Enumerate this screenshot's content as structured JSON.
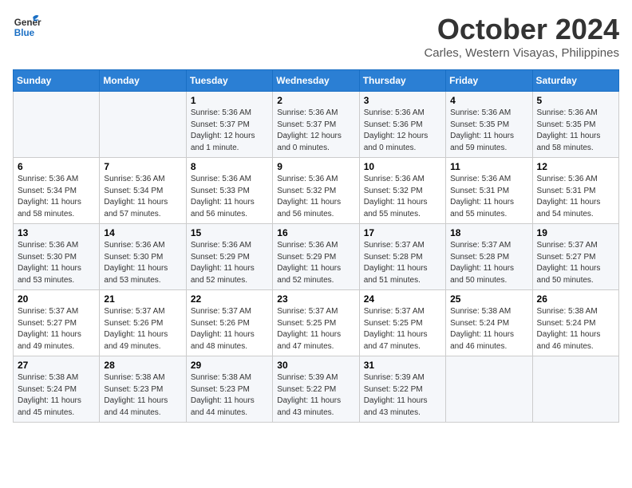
{
  "header": {
    "logo_line1": "General",
    "logo_line2": "Blue",
    "title": "October 2024",
    "subtitle": "Carles, Western Visayas, Philippines"
  },
  "weekdays": [
    "Sunday",
    "Monday",
    "Tuesday",
    "Wednesday",
    "Thursday",
    "Friday",
    "Saturday"
  ],
  "weeks": [
    [
      {
        "day": "",
        "info": ""
      },
      {
        "day": "",
        "info": ""
      },
      {
        "day": "1",
        "info": "Sunrise: 5:36 AM\nSunset: 5:37 PM\nDaylight: 12 hours\nand 1 minute."
      },
      {
        "day": "2",
        "info": "Sunrise: 5:36 AM\nSunset: 5:37 PM\nDaylight: 12 hours\nand 0 minutes."
      },
      {
        "day": "3",
        "info": "Sunrise: 5:36 AM\nSunset: 5:36 PM\nDaylight: 12 hours\nand 0 minutes."
      },
      {
        "day": "4",
        "info": "Sunrise: 5:36 AM\nSunset: 5:35 PM\nDaylight: 11 hours\nand 59 minutes."
      },
      {
        "day": "5",
        "info": "Sunrise: 5:36 AM\nSunset: 5:35 PM\nDaylight: 11 hours\nand 58 minutes."
      }
    ],
    [
      {
        "day": "6",
        "info": "Sunrise: 5:36 AM\nSunset: 5:34 PM\nDaylight: 11 hours\nand 58 minutes."
      },
      {
        "day": "7",
        "info": "Sunrise: 5:36 AM\nSunset: 5:34 PM\nDaylight: 11 hours\nand 57 minutes."
      },
      {
        "day": "8",
        "info": "Sunrise: 5:36 AM\nSunset: 5:33 PM\nDaylight: 11 hours\nand 56 minutes."
      },
      {
        "day": "9",
        "info": "Sunrise: 5:36 AM\nSunset: 5:32 PM\nDaylight: 11 hours\nand 56 minutes."
      },
      {
        "day": "10",
        "info": "Sunrise: 5:36 AM\nSunset: 5:32 PM\nDaylight: 11 hours\nand 55 minutes."
      },
      {
        "day": "11",
        "info": "Sunrise: 5:36 AM\nSunset: 5:31 PM\nDaylight: 11 hours\nand 55 minutes."
      },
      {
        "day": "12",
        "info": "Sunrise: 5:36 AM\nSunset: 5:31 PM\nDaylight: 11 hours\nand 54 minutes."
      }
    ],
    [
      {
        "day": "13",
        "info": "Sunrise: 5:36 AM\nSunset: 5:30 PM\nDaylight: 11 hours\nand 53 minutes."
      },
      {
        "day": "14",
        "info": "Sunrise: 5:36 AM\nSunset: 5:30 PM\nDaylight: 11 hours\nand 53 minutes."
      },
      {
        "day": "15",
        "info": "Sunrise: 5:36 AM\nSunset: 5:29 PM\nDaylight: 11 hours\nand 52 minutes."
      },
      {
        "day": "16",
        "info": "Sunrise: 5:36 AM\nSunset: 5:29 PM\nDaylight: 11 hours\nand 52 minutes."
      },
      {
        "day": "17",
        "info": "Sunrise: 5:37 AM\nSunset: 5:28 PM\nDaylight: 11 hours\nand 51 minutes."
      },
      {
        "day": "18",
        "info": "Sunrise: 5:37 AM\nSunset: 5:28 PM\nDaylight: 11 hours\nand 50 minutes."
      },
      {
        "day": "19",
        "info": "Sunrise: 5:37 AM\nSunset: 5:27 PM\nDaylight: 11 hours\nand 50 minutes."
      }
    ],
    [
      {
        "day": "20",
        "info": "Sunrise: 5:37 AM\nSunset: 5:27 PM\nDaylight: 11 hours\nand 49 minutes."
      },
      {
        "day": "21",
        "info": "Sunrise: 5:37 AM\nSunset: 5:26 PM\nDaylight: 11 hours\nand 49 minutes."
      },
      {
        "day": "22",
        "info": "Sunrise: 5:37 AM\nSunset: 5:26 PM\nDaylight: 11 hours\nand 48 minutes."
      },
      {
        "day": "23",
        "info": "Sunrise: 5:37 AM\nSunset: 5:25 PM\nDaylight: 11 hours\nand 47 minutes."
      },
      {
        "day": "24",
        "info": "Sunrise: 5:37 AM\nSunset: 5:25 PM\nDaylight: 11 hours\nand 47 minutes."
      },
      {
        "day": "25",
        "info": "Sunrise: 5:38 AM\nSunset: 5:24 PM\nDaylight: 11 hours\nand 46 minutes."
      },
      {
        "day": "26",
        "info": "Sunrise: 5:38 AM\nSunset: 5:24 PM\nDaylight: 11 hours\nand 46 minutes."
      }
    ],
    [
      {
        "day": "27",
        "info": "Sunrise: 5:38 AM\nSunset: 5:24 PM\nDaylight: 11 hours\nand 45 minutes."
      },
      {
        "day": "28",
        "info": "Sunrise: 5:38 AM\nSunset: 5:23 PM\nDaylight: 11 hours\nand 44 minutes."
      },
      {
        "day": "29",
        "info": "Sunrise: 5:38 AM\nSunset: 5:23 PM\nDaylight: 11 hours\nand 44 minutes."
      },
      {
        "day": "30",
        "info": "Sunrise: 5:39 AM\nSunset: 5:22 PM\nDaylight: 11 hours\nand 43 minutes."
      },
      {
        "day": "31",
        "info": "Sunrise: 5:39 AM\nSunset: 5:22 PM\nDaylight: 11 hours\nand 43 minutes."
      },
      {
        "day": "",
        "info": ""
      },
      {
        "day": "",
        "info": ""
      }
    ]
  ]
}
